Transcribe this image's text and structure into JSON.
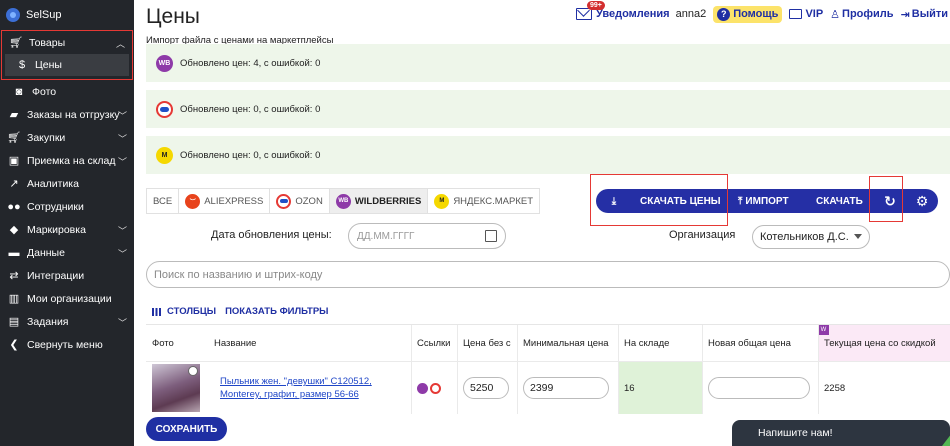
{
  "sidebar": {
    "brand": "SelSup",
    "items": [
      {
        "label": "Товары",
        "icon": "cart-icon",
        "chevron": "⌃"
      },
      {
        "label": "Цены",
        "icon": "dollar-icon"
      },
      {
        "label": "Фото",
        "icon": "camera-icon"
      },
      {
        "label": "Заказы на отгрузку",
        "icon": "truck-icon",
        "chevron": "⌄"
      },
      {
        "label": "Закупки",
        "icon": "cart-icon",
        "chevron": "⌄"
      },
      {
        "label": "Приемка на склад",
        "icon": "box-icon",
        "chevron": "⌄"
      },
      {
        "label": "Аналитика",
        "icon": "chart-icon"
      },
      {
        "label": "Сотрудники",
        "icon": "people-icon"
      },
      {
        "label": "Маркировка",
        "icon": "tag-icon",
        "chevron": "⌄"
      },
      {
        "label": "Данные",
        "icon": "folder-icon",
        "chevron": "⌄"
      },
      {
        "label": "Интеграции",
        "icon": "swap-icon"
      },
      {
        "label": "Мои организации",
        "icon": "building-icon"
      },
      {
        "label": "Задания",
        "icon": "clipboard-icon",
        "chevron": "⌄"
      },
      {
        "label": "Свернуть меню",
        "icon": "chevron-left-icon"
      }
    ]
  },
  "header": {
    "title": "Цены",
    "subtitle": "Импорт файла с ценами на маркетплейсы",
    "notifications_badge": "99+",
    "notifications": "Уведомления",
    "user": "anna2",
    "help": "Помощь",
    "vip": "VIP",
    "profile": "Профиль",
    "logout": "Выйти"
  },
  "status": [
    {
      "marketplace": "WB",
      "text": "Обновлено цен: 4, с ошибкой: 0",
      "color": "#8e3aa8"
    },
    {
      "marketplace": "OZON",
      "text": "Обновлено цен: 0, с ошибкой: 0",
      "color": "#e53935"
    },
    {
      "marketplace": "YM",
      "text": "Обновлено цен: 0, с ошибкой: 0",
      "color": "#f5d800"
    }
  ],
  "tabs": [
    {
      "label": "ВСЕ"
    },
    {
      "label": "ALIEXPRESS"
    },
    {
      "label": "OZON"
    },
    {
      "label": "WILDBERRIES",
      "active": true
    },
    {
      "label": "ЯНДЕКС.МАРКЕТ"
    }
  ],
  "actions": {
    "download_prices": "СКАЧАТЬ ЦЕНЫ",
    "import": "ИМПОРТ",
    "download": "СКАЧАТЬ"
  },
  "filters": {
    "date_label": "Дата обновления цены:",
    "date_placeholder": "ДД.ММ.ГГГГ",
    "org_label": "Организация",
    "org_value": "Котельников Д.С.",
    "search_placeholder": "Поиск по названию и штрих-коду",
    "columns": "СТОЛБЦЫ",
    "show_filters": "ПОКАЗАТЬ ФИЛЬТРЫ"
  },
  "table": {
    "headers": [
      "Фото",
      "Название",
      "Ссылки",
      "Цена без с",
      "Минимальная цена",
      "На складе",
      "Новая общая цена",
      "Текущая цена со скидкой"
    ],
    "rows": [
      {
        "name": "Пыльник жен. \"девушки\" С120512, Monterey, графит, размер 56-66",
        "price": "5250",
        "min_price": "2399",
        "stock": "16",
        "new_price": "",
        "current_price": "2258"
      }
    ]
  },
  "footer": {
    "save": "СОХРАНИТЬ",
    "chat": "Напишите нам!"
  }
}
